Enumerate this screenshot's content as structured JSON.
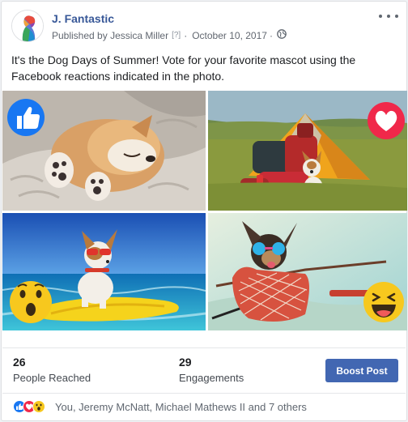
{
  "page": {
    "name": "J. Fantastic",
    "published_prefix": "Published by",
    "publisher": "Jessica Miller",
    "help_marker": "[?]",
    "date": "October 10, 2017",
    "separator": "·"
  },
  "post": {
    "text": "It's the Dog Days of Summer! Vote for your favorite mascot using the Facebook reactions indicated in the photo."
  },
  "photos": [
    {
      "reaction": "like-icon"
    },
    {
      "reaction": "love-icon"
    },
    {
      "reaction": "wow-icon"
    },
    {
      "reaction": "haha-icon"
    }
  ],
  "stats": {
    "reached_value": "26",
    "reached_label": "People Reached",
    "engagements_value": "29",
    "engagements_label": "Engagements"
  },
  "boost_label": "Boost Post",
  "reactions_summary": "You, Jeremy McNatt, Michael Mathews II and 7 others",
  "colors": {
    "link": "#385898",
    "boost": "#4267b2",
    "like": "#1877f2",
    "love": "#f0284a",
    "emoji": "#f7c81e"
  }
}
